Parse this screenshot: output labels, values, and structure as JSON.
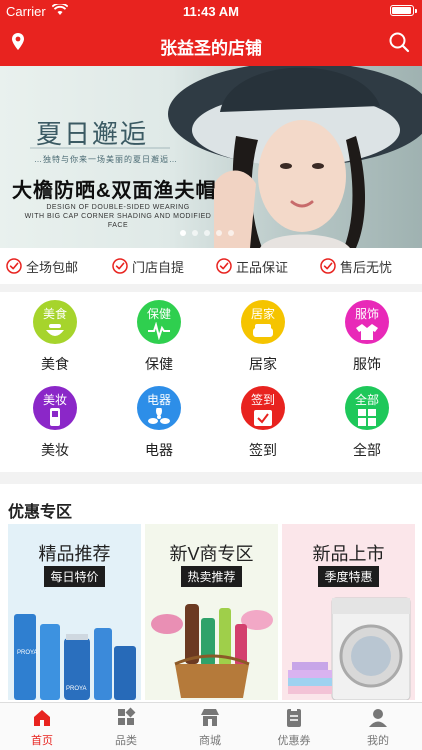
{
  "status_bar": {
    "carrier": "Carrier",
    "time": "11:43 AM"
  },
  "nav": {
    "title": "张益圣的店铺",
    "left_icon": "location-pin-icon",
    "right_icon": "search-icon"
  },
  "banner": {
    "headline_art": "夏日邂逅",
    "tagline": "…独特与你来一场美丽的夏日邂逅…",
    "title": "大檐防晒&双面渔夫帽",
    "subtitle_line1": "DESIGN OF DOUBLE-SIDED WEARING",
    "subtitle_line2": "WITH BIG CAP CORNER SHADING AND MODIFIED FACE",
    "slide_count": 5,
    "active_slide": 1
  },
  "features": [
    {
      "label": "全场包邮"
    },
    {
      "label": "门店自提"
    },
    {
      "label": "正品保证"
    },
    {
      "label": "售后无忧"
    }
  ],
  "categories": [
    {
      "tag": "美食",
      "label": "美食",
      "color": "#a6d42c",
      "icon": "food-icon"
    },
    {
      "tag": "保健",
      "label": "保健",
      "color": "#2fcf4f",
      "icon": "health-icon"
    },
    {
      "tag": "居家",
      "label": "居家",
      "color": "#f5c400",
      "icon": "home-sofa-icon"
    },
    {
      "tag": "服饰",
      "label": "服饰",
      "color": "#e829b8",
      "icon": "clothing-icon"
    },
    {
      "tag": "美妆",
      "label": "美妆",
      "color": "#8b27c8",
      "icon": "makeup-icon"
    },
    {
      "tag": "电器",
      "label": "电器",
      "color": "#2d8ee8",
      "icon": "fan-icon"
    },
    {
      "tag": "签到",
      "label": "签到",
      "color": "#e8231f",
      "icon": "calendar-check-icon"
    },
    {
      "tag": "全部",
      "label": "全部",
      "color": "#1ec85a",
      "icon": "grid-all-icon"
    }
  ],
  "promo": {
    "heading": "优惠专区",
    "cards": [
      {
        "title": "精品推荐",
        "subtitle": "每日特价",
        "bg": "#e3f1f8"
      },
      {
        "title": "新V商专区",
        "subtitle": "热卖推荐",
        "bg": "#f3f7ec"
      },
      {
        "title": "新品上市",
        "subtitle": "季度特惠",
        "bg": "#fbe6ea"
      }
    ],
    "product_brand": "PROYA"
  },
  "tabs": [
    {
      "label": "首页",
      "icon": "home-icon",
      "active": true
    },
    {
      "label": "品类",
      "icon": "category-icon",
      "active": false
    },
    {
      "label": "商城",
      "icon": "store-icon",
      "active": false
    },
    {
      "label": "优惠券",
      "icon": "coupon-icon",
      "active": false
    },
    {
      "label": "我的",
      "icon": "user-icon",
      "active": false
    }
  ],
  "colors": {
    "brand_red": "#e8231f"
  }
}
